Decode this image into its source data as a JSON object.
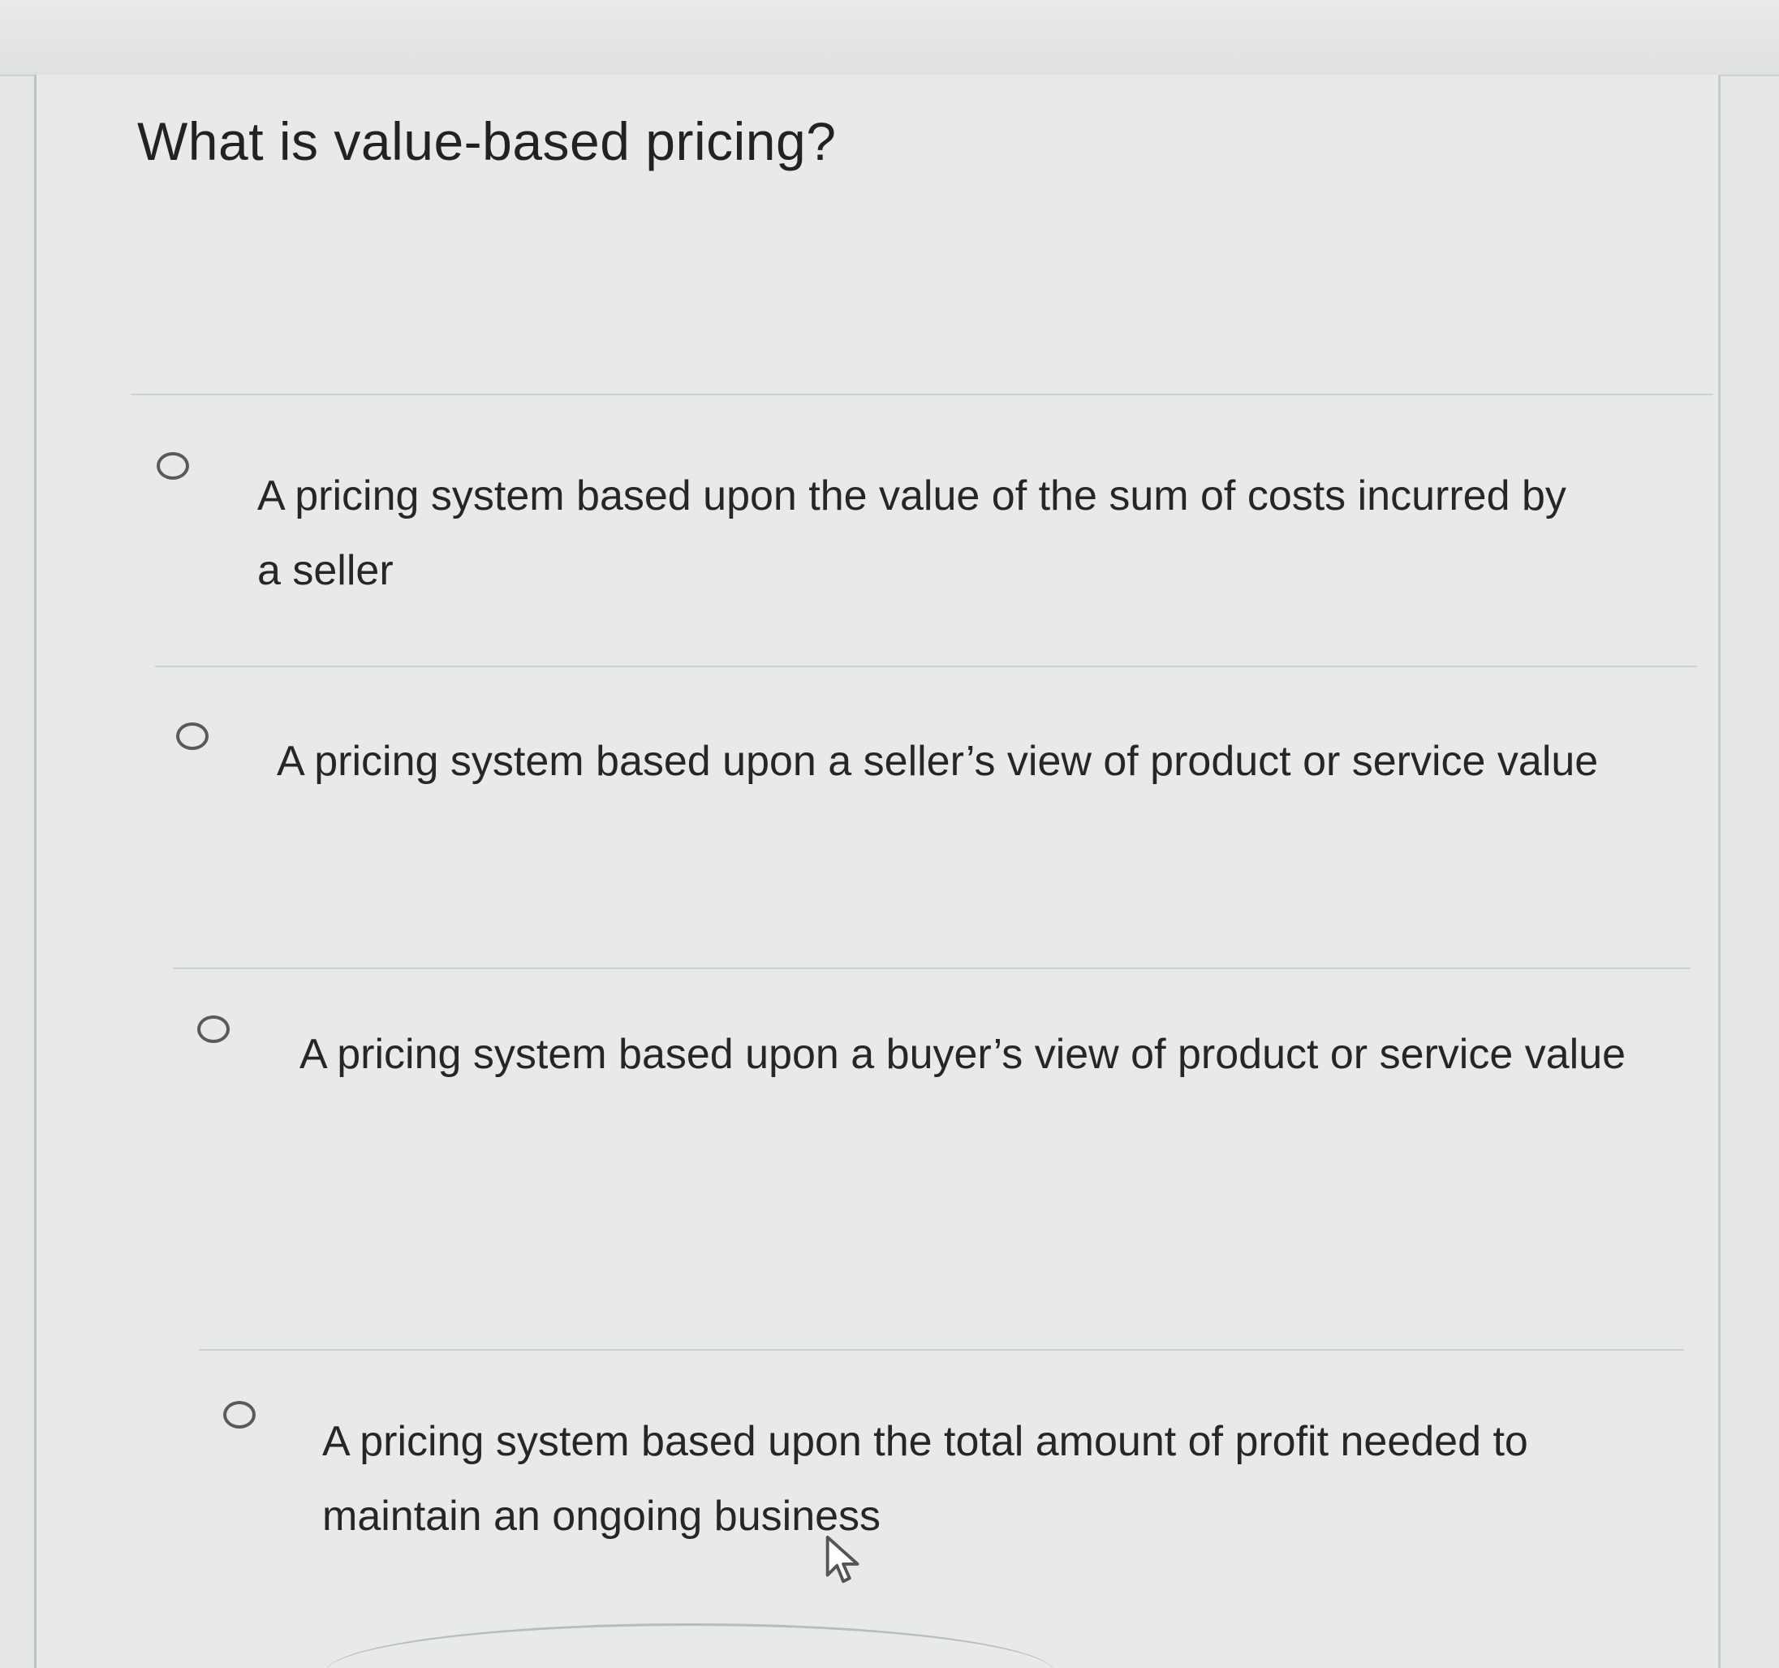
{
  "question": {
    "title": "What is value-based pricing?"
  },
  "options": [
    {
      "text": "A pricing system based upon the value of the sum of costs incurred by a seller",
      "selected": false
    },
    {
      "text": "A pricing system based upon a seller’s view of product or service value",
      "selected": false
    },
    {
      "text": "A pricing system based upon a buyer’s view of product or service value",
      "selected": false
    },
    {
      "text": "A pricing system based upon the total amount of profit needed to maintain an ongoing business",
      "selected": false
    }
  ],
  "icons": {
    "radio": "radio-unselected-icon",
    "cursor": "mouse-pointer-icon"
  }
}
